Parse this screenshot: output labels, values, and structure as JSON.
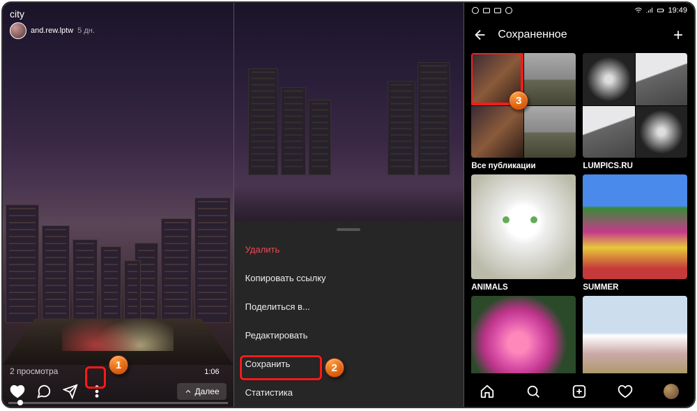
{
  "panel1": {
    "title": "city",
    "username": "and.rew.lptw",
    "time_ago": "5 дн.",
    "views": "2 просмотра",
    "next_label": "Далее",
    "timecode": "1:06",
    "callout": "1"
  },
  "panel2": {
    "menu": {
      "delete": "Удалить",
      "copy_link": "Копировать ссылку",
      "share": "Поделиться в...",
      "edit": "Редактировать",
      "save": "Сохранить",
      "stats": "Статистика"
    },
    "callout": "2"
  },
  "panel3": {
    "status_time": "19:49",
    "header_title": "Сохраненное",
    "collections": {
      "all": "Все публикации",
      "lumpics": "LUMPICS.RU",
      "animals": "ANIMALS",
      "summer": "SUMMER"
    },
    "callout": "3"
  }
}
